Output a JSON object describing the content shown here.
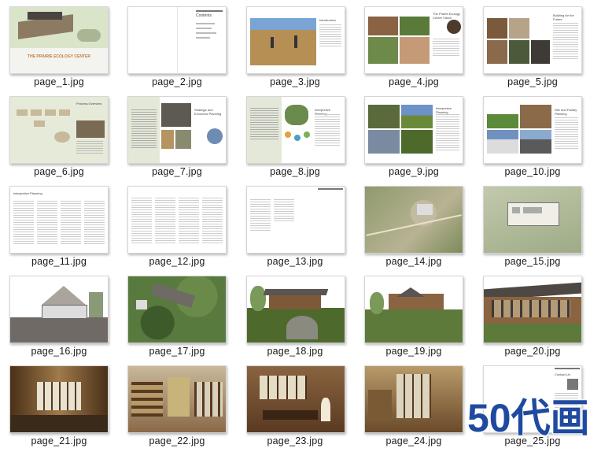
{
  "files": [
    {
      "name": "page_1.jpg"
    },
    {
      "name": "page_2.jpg"
    },
    {
      "name": "page_3.jpg"
    },
    {
      "name": "page_4.jpg"
    },
    {
      "name": "page_5.jpg"
    },
    {
      "name": "page_6.jpg"
    },
    {
      "name": "page_7.jpg"
    },
    {
      "name": "page_8.jpg"
    },
    {
      "name": "page_9.jpg"
    },
    {
      "name": "page_10.jpg"
    },
    {
      "name": "page_11.jpg"
    },
    {
      "name": "page_12.jpg"
    },
    {
      "name": "page_13.jpg"
    },
    {
      "name": "page_14.jpg"
    },
    {
      "name": "page_15.jpg"
    },
    {
      "name": "page_16.jpg"
    },
    {
      "name": "page_17.jpg"
    },
    {
      "name": "page_18.jpg"
    },
    {
      "name": "page_19.jpg"
    },
    {
      "name": "page_20.jpg"
    },
    {
      "name": "page_21.jpg"
    },
    {
      "name": "page_22.jpg"
    },
    {
      "name": "page_23.jpg"
    },
    {
      "name": "page_24.jpg"
    },
    {
      "name": "page_25.jpg"
    }
  ],
  "cover_title": "THE PRAIRIE ECOLOGY CENTER",
  "page2_heading": "Contents",
  "page3_heading": "Introduction",
  "page4_heading": "The Prairie Ecology Center Vision",
  "page5_heading": "Building for the Future",
  "page6_heading": "Process Overview",
  "page7_heading": "Strategic and Economic Planning",
  "page8_heading": "Interpretive Planning",
  "page9_heading": "Interpretive Planning",
  "page10_heading": "Site and Facility Planning",
  "page11_heading": "Interpretive Planning",
  "page25_heading": "Contact Us",
  "watermark": "50代画"
}
